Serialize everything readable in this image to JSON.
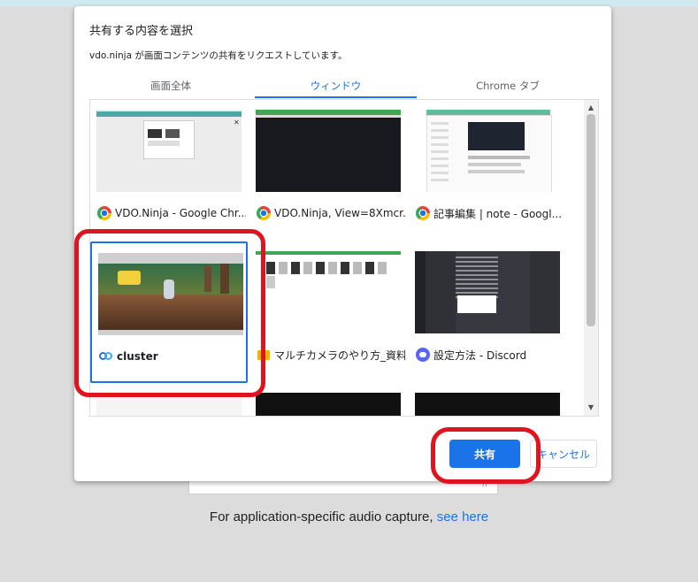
{
  "page": {
    "footer_text": "For application-specific audio capture,",
    "footer_link": "see here"
  },
  "dialog": {
    "title": "共有する内容を選択",
    "subtitle": "vdo.ninja が画面コンテンツの共有をリクエストしています。",
    "tabs": [
      {
        "label": "画面全体",
        "active": false
      },
      {
        "label": "ウィンドウ",
        "active": true
      },
      {
        "label": "Chrome タブ",
        "active": false
      }
    ],
    "windows": [
      {
        "label": "VDO.Ninja - Google Chr...",
        "icon": "chrome-icon"
      },
      {
        "label": "VDO.Ninja, View=8Xmcr...",
        "icon": "chrome-icon"
      },
      {
        "label": "記事編集 | note - Googl...",
        "icon": "chrome-icon"
      },
      {
        "label": "cluster",
        "icon": "cluster-icon",
        "selected": true
      },
      {
        "label": "マルチカメラのやり方_資料",
        "icon": "folder-icon"
      },
      {
        "label": "設定方法 - Discord",
        "icon": "discord-icon"
      }
    ],
    "share_label": "共有",
    "cancel_label": "キャンセル"
  },
  "colors": {
    "accent": "#1a73e8",
    "highlight": "#e0141e"
  }
}
